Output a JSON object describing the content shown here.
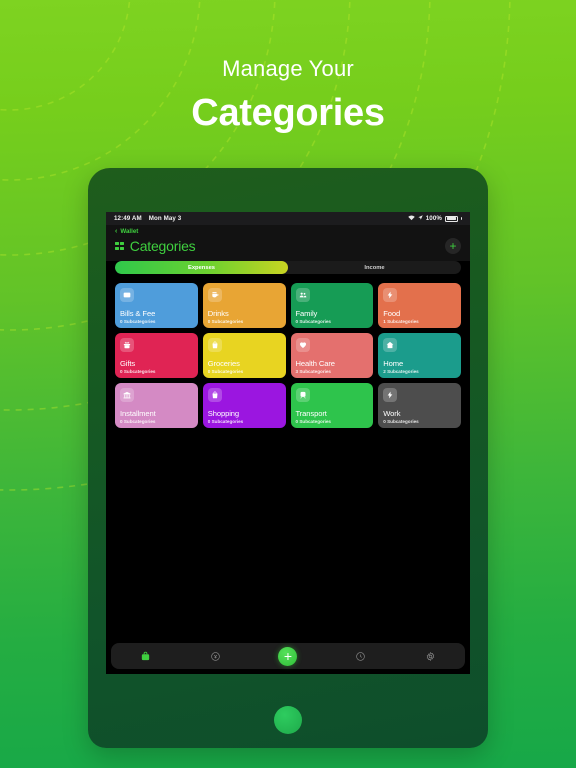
{
  "hero": {
    "subtitle": "Manage Your",
    "title": "Categories"
  },
  "statusbar": {
    "time": "12:49 AM",
    "date": "Mon May 3",
    "battery_percent": "100%",
    "wifi_icon": "wifi-icon",
    "location_icon": "location-arrow-icon",
    "battery_icon": "battery-full-icon"
  },
  "nav": {
    "back_label": "Wallet",
    "back_chevron_icon": "chevron-left-icon",
    "title": "Categories",
    "title_icon": "grid-icon",
    "add_label": "+",
    "add_icon": "plus-icon"
  },
  "segmented": {
    "options": [
      "Expenses",
      "Income"
    ],
    "selected_index": 0,
    "active_gradient_from": "#2fc84b",
    "active_gradient_to": "#c9d422"
  },
  "categories": [
    {
      "name": "Bills & Fee",
      "subtitle": "0 Subcategories",
      "color": "#4f9ddb",
      "icon": "credit-card-icon"
    },
    {
      "name": "Drinks",
      "subtitle": "0 Subcategories",
      "color": "#e8a534",
      "icon": "coffee-cup-icon"
    },
    {
      "name": "Family",
      "subtitle": "0 Subcategories",
      "color": "#169c55",
      "icon": "people-icon"
    },
    {
      "name": "Food",
      "subtitle": "1 Subcategories",
      "color": "#e3704c",
      "icon": "bolt-icon"
    },
    {
      "name": "Gifts",
      "subtitle": "0 Subcategories",
      "color": "#e02454",
      "icon": "gift-icon"
    },
    {
      "name": "Groceries",
      "subtitle": "0 Subcategories",
      "color": "#e8d421",
      "icon": "shopping-bag-icon"
    },
    {
      "name": "Health Care",
      "subtitle": "3 Subcategories",
      "color": "#e4706e",
      "icon": "heart-icon"
    },
    {
      "name": "Home",
      "subtitle": "2 Subcategories",
      "color": "#1b9c8c",
      "icon": "home-icon"
    },
    {
      "name": "Installment",
      "subtitle": "0 Subcategories",
      "color": "#d48ac4",
      "icon": "bank-icon"
    },
    {
      "name": "Shopping",
      "subtitle": "0 Subcategories",
      "color": "#9b16e0",
      "icon": "shopping-bag-icon"
    },
    {
      "name": "Transport",
      "subtitle": "0 Subcategories",
      "color": "#2ec44c",
      "icon": "train-icon"
    },
    {
      "name": "Work",
      "subtitle": "0 Subcategories",
      "color": "#4d4d4d",
      "icon": "bolt-icon"
    }
  ],
  "tabbar": {
    "items": [
      {
        "icon": "wallet-icon",
        "active": true
      },
      {
        "icon": "currency-icon",
        "active": false
      },
      {
        "icon": "plus-icon",
        "active": false
      },
      {
        "icon": "clock-icon",
        "active": false
      },
      {
        "icon": "gear-icon",
        "active": false
      }
    ],
    "add_label": "+"
  },
  "device": {
    "home_button_icon": "home-button"
  }
}
